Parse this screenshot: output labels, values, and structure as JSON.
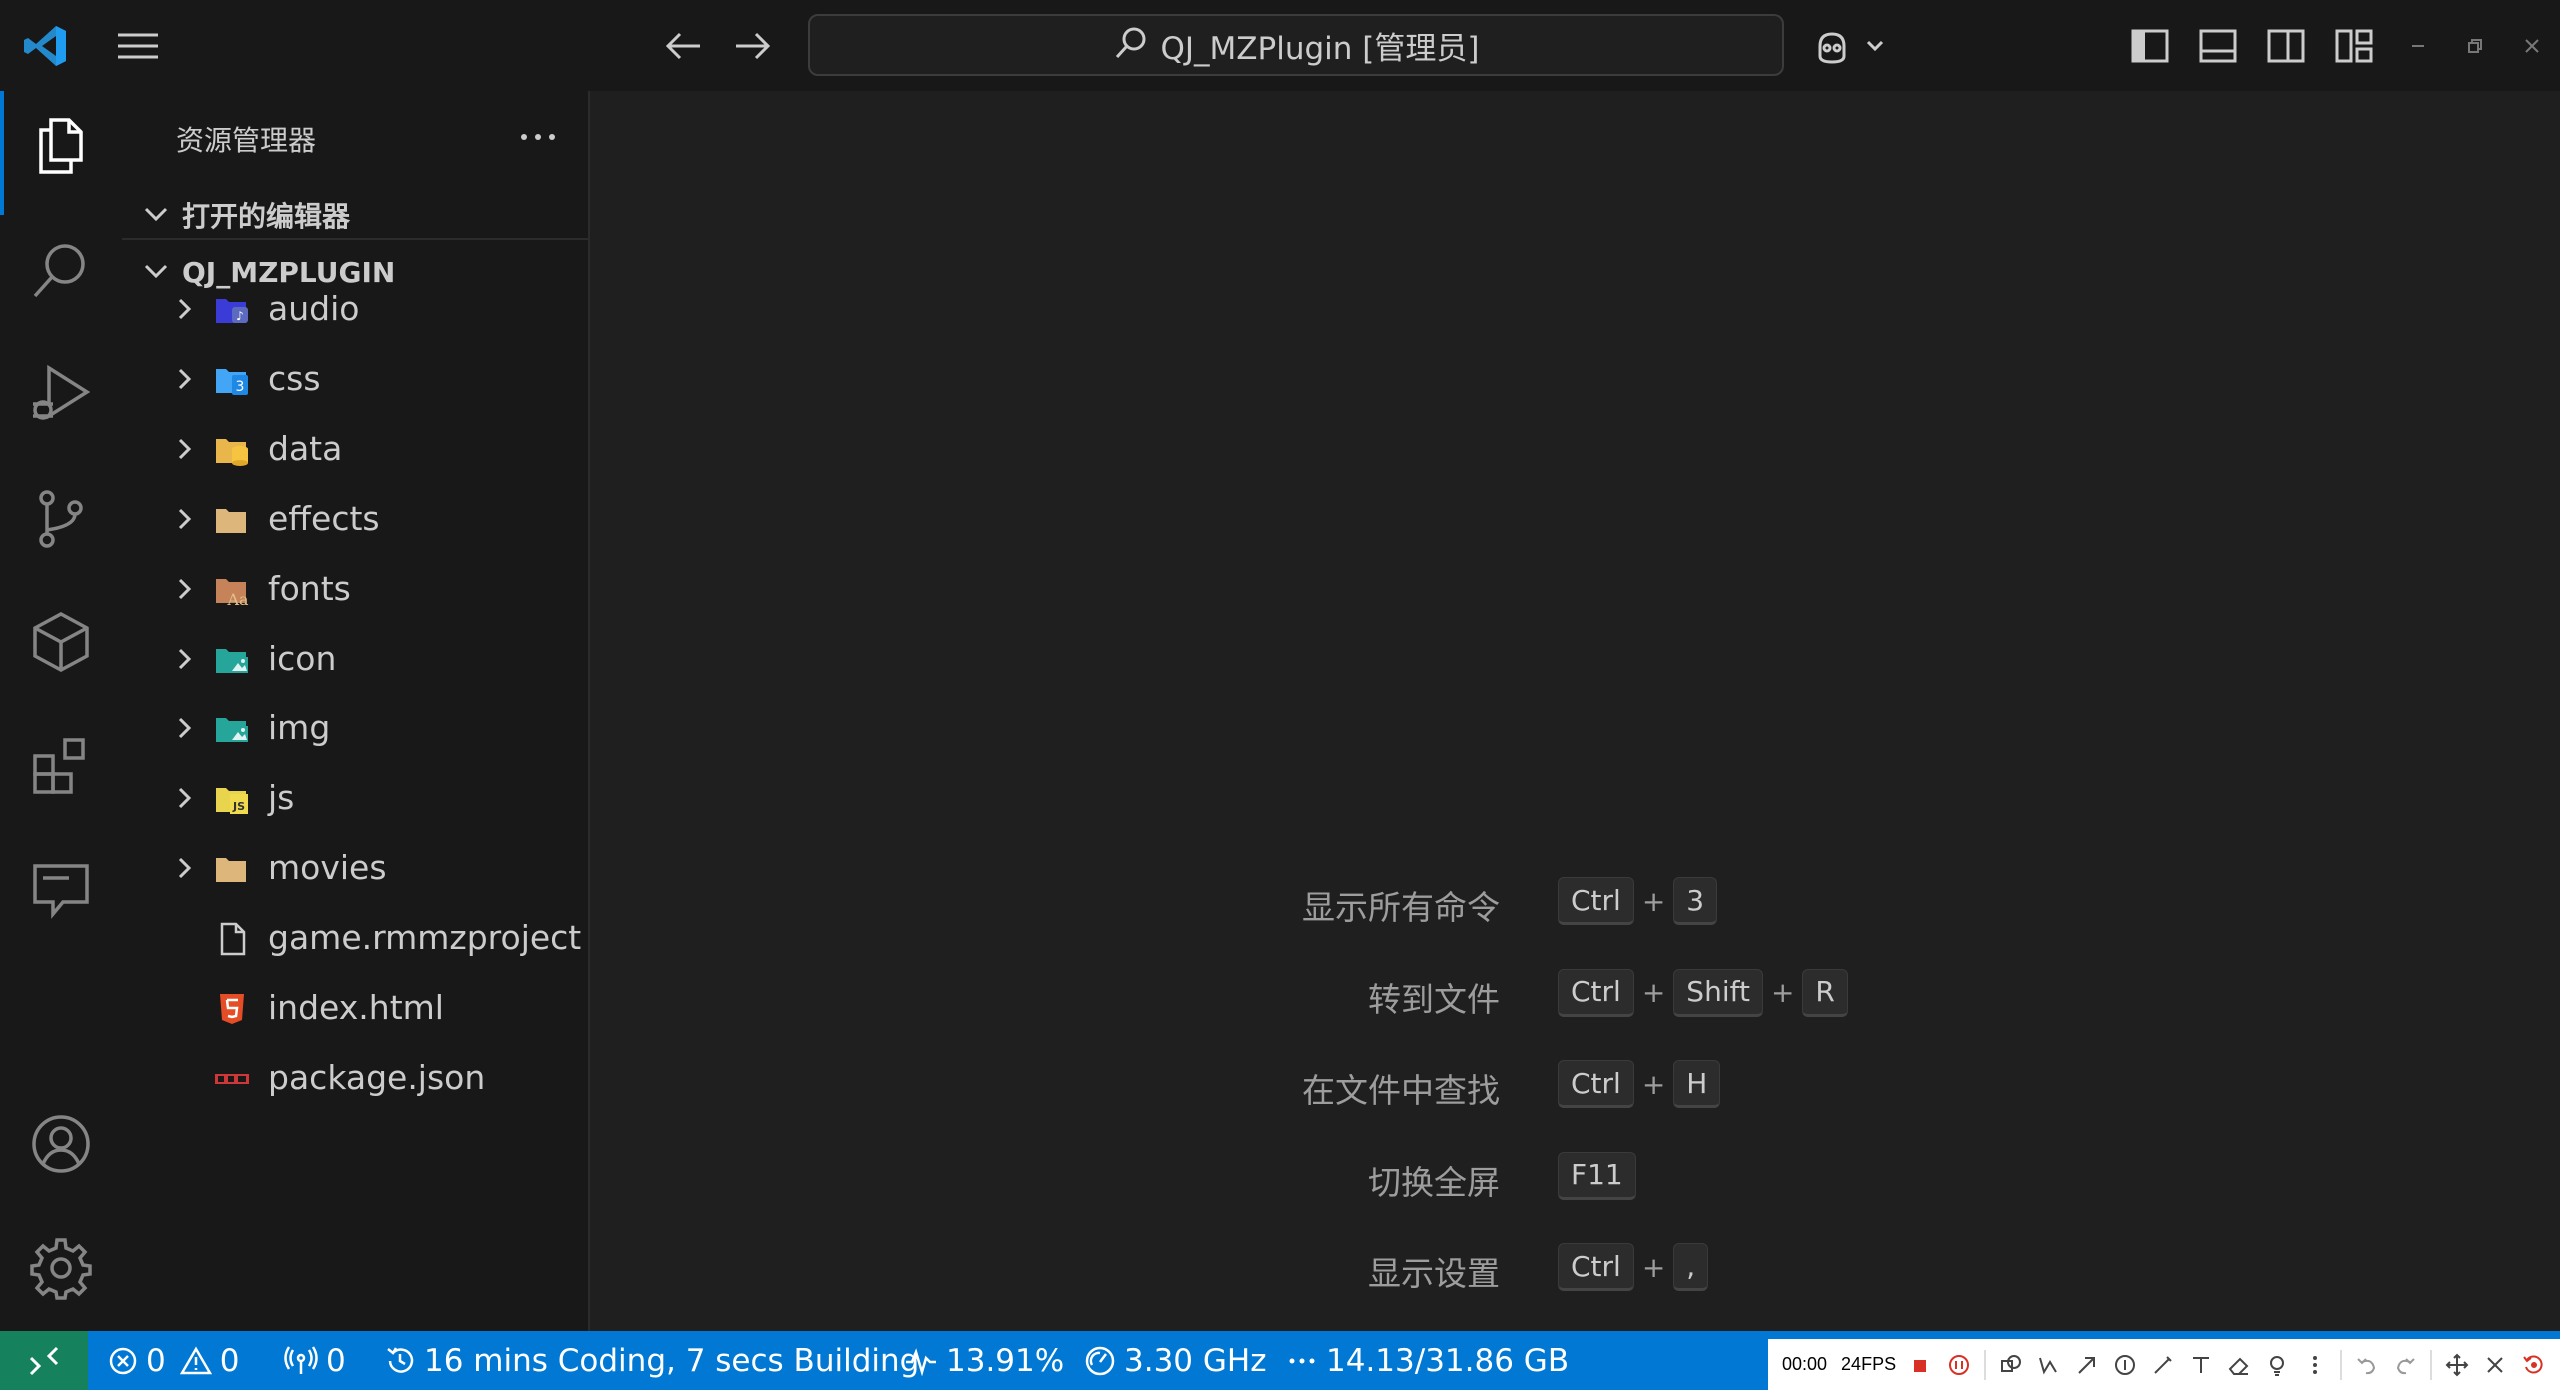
{
  "titlebar": {
    "search_text": "QJ_MZPlugin [管理员]"
  },
  "sidebar": {
    "title": "资源管理器",
    "open_editors_label": "打开的编辑器",
    "project_label": "QJ_MZPLUGIN",
    "items": [
      {
        "name": "audio",
        "kind": "folder",
        "icon": "audio-folder-icon",
        "color": "#3b3bd8"
      },
      {
        "name": "css",
        "kind": "folder",
        "icon": "css-folder-icon",
        "color": "#42a5f5"
      },
      {
        "name": "data",
        "kind": "folder",
        "icon": "database-folder-icon",
        "color": "#e8b64a"
      },
      {
        "name": "effects",
        "kind": "folder",
        "icon": "folder-icon",
        "color": "#dcb67a"
      },
      {
        "name": "fonts",
        "kind": "folder",
        "icon": "font-folder-icon",
        "color": "#c6835a"
      },
      {
        "name": "icon",
        "kind": "folder",
        "icon": "image-folder-icon",
        "color": "#26a69a"
      },
      {
        "name": "img",
        "kind": "folder",
        "icon": "image-folder-icon",
        "color": "#26a69a"
      },
      {
        "name": "js",
        "kind": "folder",
        "icon": "js-folder-icon",
        "color": "#e8d44d"
      },
      {
        "name": "movies",
        "kind": "folder",
        "icon": "folder-icon",
        "color": "#dcb67a"
      },
      {
        "name": "game.rmmzproject",
        "kind": "file",
        "icon": "file-icon",
        "color": "#cccccc"
      },
      {
        "name": "index.html",
        "kind": "file",
        "icon": "html5-icon",
        "color": "#e44d26"
      },
      {
        "name": "package.json",
        "kind": "file",
        "icon": "npm-icon",
        "color": "#cb3837"
      }
    ]
  },
  "editor": {
    "hints": [
      {
        "label": "显示所有命令",
        "keys": [
          "Ctrl",
          "3"
        ]
      },
      {
        "label": "转到文件",
        "keys": [
          "Ctrl",
          "Shift",
          "R"
        ]
      },
      {
        "label": "在文件中查找",
        "keys": [
          "Ctrl",
          "H"
        ]
      },
      {
        "label": "切换全屏",
        "keys": [
          "F11"
        ]
      },
      {
        "label": "显示设置",
        "keys": [
          "Ctrl",
          ","
        ]
      }
    ]
  },
  "statusbar": {
    "errors": "0",
    "warnings": "0",
    "ports": "0",
    "wakatime": "16 mins Coding, 7 secs Building",
    "cpu": "13.91%",
    "freq": "3.30 GHz",
    "memory": "14.13/31.86 GB",
    "recorder_time": "00:00",
    "recorder_fps": "24FPS"
  },
  "colors": {
    "accent": "#0078d4",
    "remote": "#16825d",
    "background": "#1f1f1f",
    "sidebar": "#181818"
  }
}
